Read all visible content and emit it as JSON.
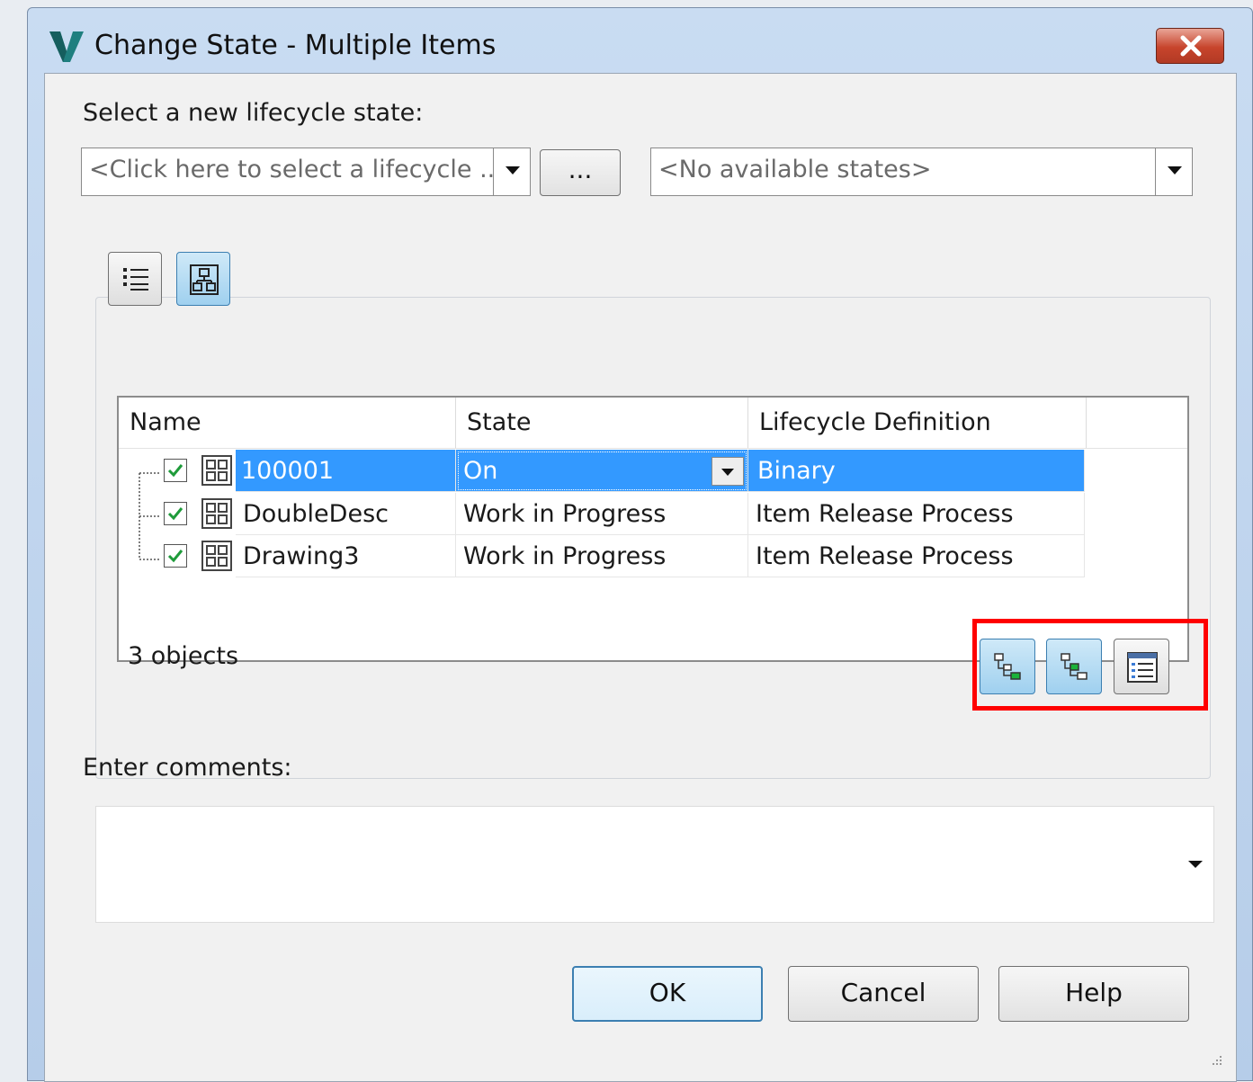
{
  "window": {
    "title": "Change State - Multiple Items",
    "close_label": "Close"
  },
  "lifecycle": {
    "prompt": "Select a new lifecycle state:",
    "lifecycle_combo": "<Click here to select a lifecycle ...",
    "browse_label": "...",
    "states_combo": "<No available states>"
  },
  "grid": {
    "columns": [
      "Name",
      "State",
      "Lifecycle Definition"
    ],
    "rows": [
      {
        "name": "100001",
        "state": "On",
        "lifecycle": "Binary",
        "checked": true,
        "selected": true
      },
      {
        "name": "DoubleDesc",
        "state": "Work in Progress",
        "lifecycle": "Item Release Process",
        "checked": true,
        "selected": false
      },
      {
        "name": "Drawing3",
        "state": "Work in Progress",
        "lifecycle": "Item Release Process",
        "checked": true,
        "selected": false
      }
    ],
    "object_count": "3 objects"
  },
  "comments": {
    "label": "Enter comments:",
    "value": ""
  },
  "buttons": {
    "ok": "OK",
    "cancel": "Cancel",
    "help": "Help"
  },
  "colors": {
    "selection": "#3399ff",
    "highlight_box": "#ff0000",
    "close_button": "#c7442c"
  },
  "icons": {
    "app": "vault-logo-icon",
    "list_view": "list-view-icon",
    "tree_view": "tree-view-icon",
    "expand_all": "expand-all-icon",
    "collapse": "collapse-icon",
    "details": "details-pane-icon"
  }
}
